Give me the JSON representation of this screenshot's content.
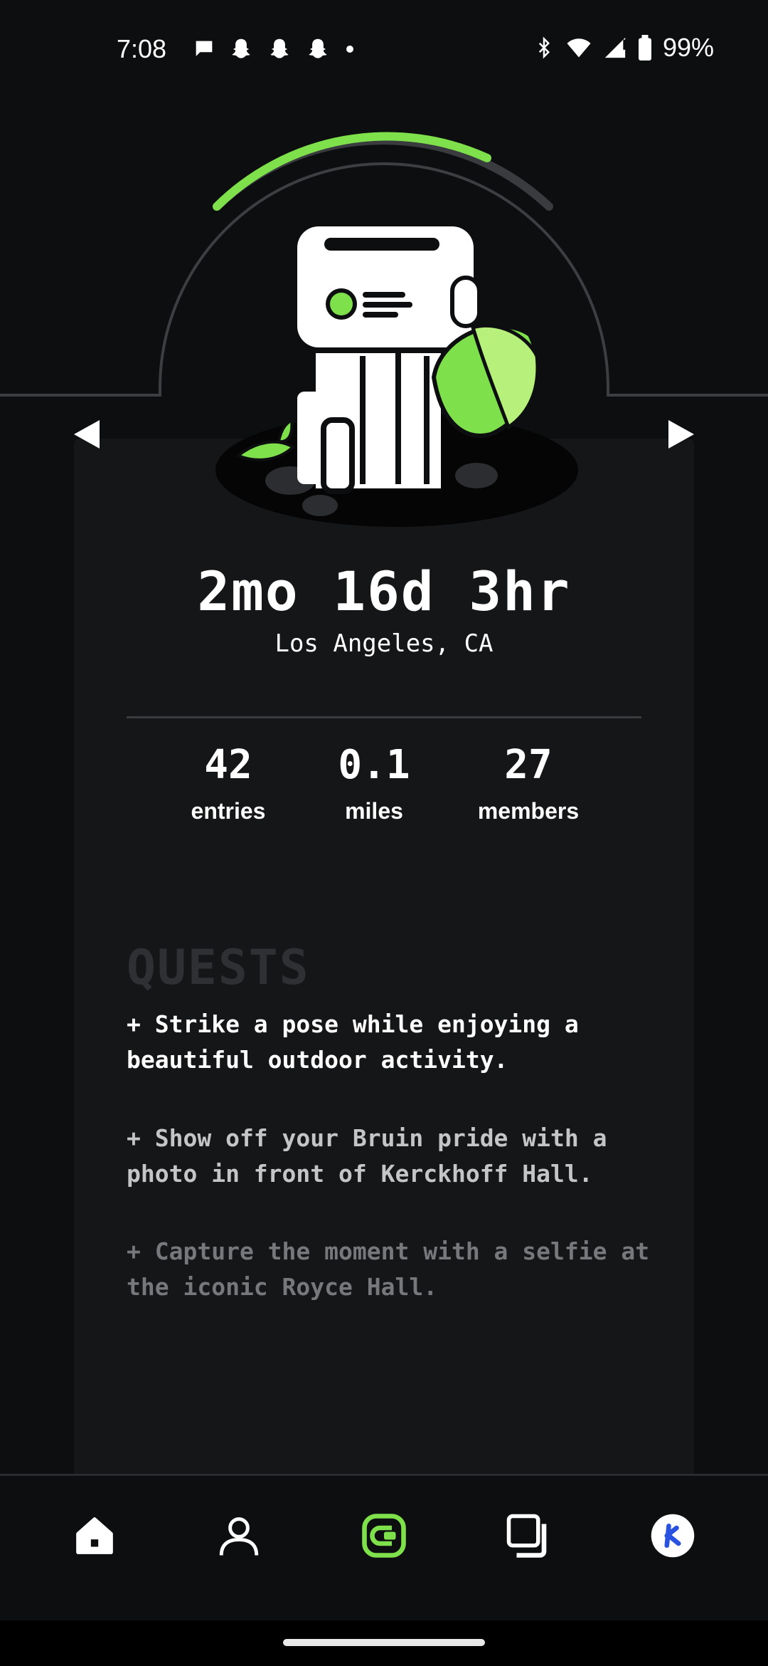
{
  "status_bar": {
    "time": "7:08",
    "battery": "99%",
    "left_icons": [
      "chat-bubble-icon",
      "snapchat-icon",
      "snapchat-icon",
      "snapchat-icon",
      "dot-icon"
    ],
    "right_icons": [
      "bluetooth-icon",
      "wifi-icon",
      "signal-icon",
      "battery-icon"
    ]
  },
  "hero": {
    "progress_fraction": 0.6,
    "accent_color": "#7ee04a"
  },
  "card": {
    "duration": "2mo 16d 3hr",
    "location": "Los Angeles, CA",
    "stats": [
      {
        "value": "42",
        "label": "entries"
      },
      {
        "value": "0.1",
        "label": "miles"
      },
      {
        "value": "27",
        "label": "members"
      }
    ]
  },
  "quests": {
    "title": "QUESTS",
    "items": [
      "+ Strike a pose while enjoying a beautiful outdoor activity.",
      "+ Show off your Bruin pride with a photo in front of Kerckhoff Hall.",
      "+ Capture the moment with a selfie at the iconic Royce Hall."
    ]
  },
  "nav": {
    "items": [
      "home-icon",
      "profile-icon",
      "capture-icon",
      "gallery-icon",
      "avatar-icon"
    ],
    "active_color": "#7ee04a"
  }
}
